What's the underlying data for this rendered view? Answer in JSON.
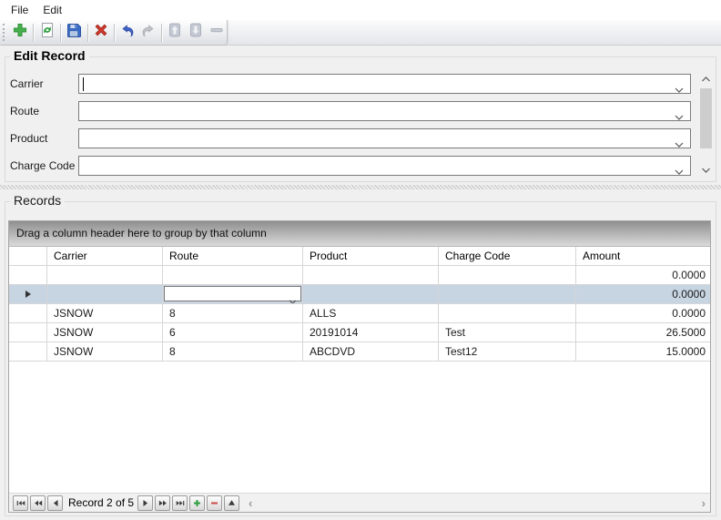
{
  "menubar": {
    "items": [
      {
        "label": "File"
      },
      {
        "label": "Edit"
      }
    ]
  },
  "toolbar": {
    "buttons": [
      {
        "id": "add",
        "icon": "plus-icon",
        "enabled": true
      },
      {
        "id": "refresh",
        "icon": "refresh-icon",
        "enabled": true
      },
      {
        "id": "save",
        "icon": "save-icon",
        "enabled": true
      },
      {
        "id": "delete",
        "icon": "delete-x-icon",
        "enabled": true
      },
      {
        "id": "undo",
        "icon": "undo-icon",
        "enabled": true
      },
      {
        "id": "redo",
        "icon": "redo-icon",
        "enabled": false
      },
      {
        "id": "move-up",
        "icon": "up-icon",
        "enabled": false
      },
      {
        "id": "move-down",
        "icon": "down-icon",
        "enabled": false
      },
      {
        "id": "remove",
        "icon": "minus-icon",
        "enabled": false
      }
    ]
  },
  "edit_record": {
    "title": "Edit Record",
    "fields": [
      {
        "label": "Carrier",
        "value": "",
        "focused": true
      },
      {
        "label": "Route",
        "value": "",
        "focused": false
      },
      {
        "label": "Product",
        "value": "",
        "focused": false
      },
      {
        "label": "Charge Code",
        "value": "",
        "focused": false
      }
    ]
  },
  "records": {
    "title": "Records",
    "group_panel_text": "Drag a column header here to group by that column",
    "columns": [
      "Carrier",
      "Route",
      "Product",
      "Charge Code",
      "Amount"
    ],
    "rows": [
      {
        "carrier": "",
        "route": "",
        "product": "",
        "charge_code": "",
        "amount": "0.0000",
        "selected": false
      },
      {
        "carrier": "",
        "route": "",
        "product": "",
        "charge_code": "",
        "amount": "0.0000",
        "selected": true,
        "editing_column": "Route"
      },
      {
        "carrier": "JSNOW",
        "route": "8",
        "product": "ALLS",
        "charge_code": "",
        "amount": "0.0000",
        "selected": false
      },
      {
        "carrier": "JSNOW",
        "route": "6",
        "product": "20191014",
        "charge_code": "Test",
        "amount": "26.5000",
        "selected": false
      },
      {
        "carrier": "JSNOW",
        "route": "8",
        "product": "ABCDVD",
        "charge_code": "Test12",
        "amount": "15.0000",
        "selected": false
      }
    ],
    "navigator": {
      "record_label": "Record 2 of 5",
      "buttons": [
        "move-first",
        "move-previous-page",
        "move-previous",
        "move-next",
        "move-next-page",
        "move-last",
        "add",
        "delete",
        "move-up"
      ]
    }
  },
  "colors": {
    "selected_row_bg": "#c7d4e2",
    "add_green": "#3fae49",
    "delete_red": "#d23b2e",
    "save_blue": "#3a6fc9",
    "undo_blue": "#3f63c8",
    "group_panel_top": "#8f8f8f",
    "group_panel_bottom": "#dadada"
  }
}
